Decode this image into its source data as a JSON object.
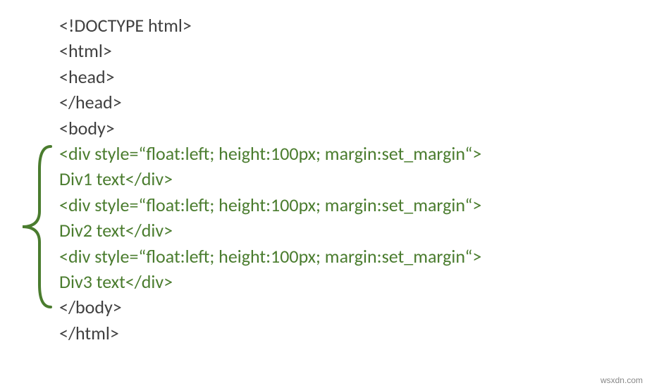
{
  "code": {
    "l1": "<!DOCTYPE html>",
    "l2": "<html>",
    "l3": "<head>",
    "l4": "</head>",
    "l5": "<body>",
    "l6": "<div style=“float:left; height:100px; margin:set_margin“>",
    "l7": "Div1 text</div>",
    "l8": "<div style=“float:left; height:100px; margin:set_margin“>",
    "l9": "Div2 text</div>",
    "l10": "<div style=“float:left; height:100px; margin:set_margin“>",
    "l11": "Div3 text</div>",
    "l12": "</body>",
    "l13": "</html>"
  },
  "watermark": "wsxdn.com"
}
